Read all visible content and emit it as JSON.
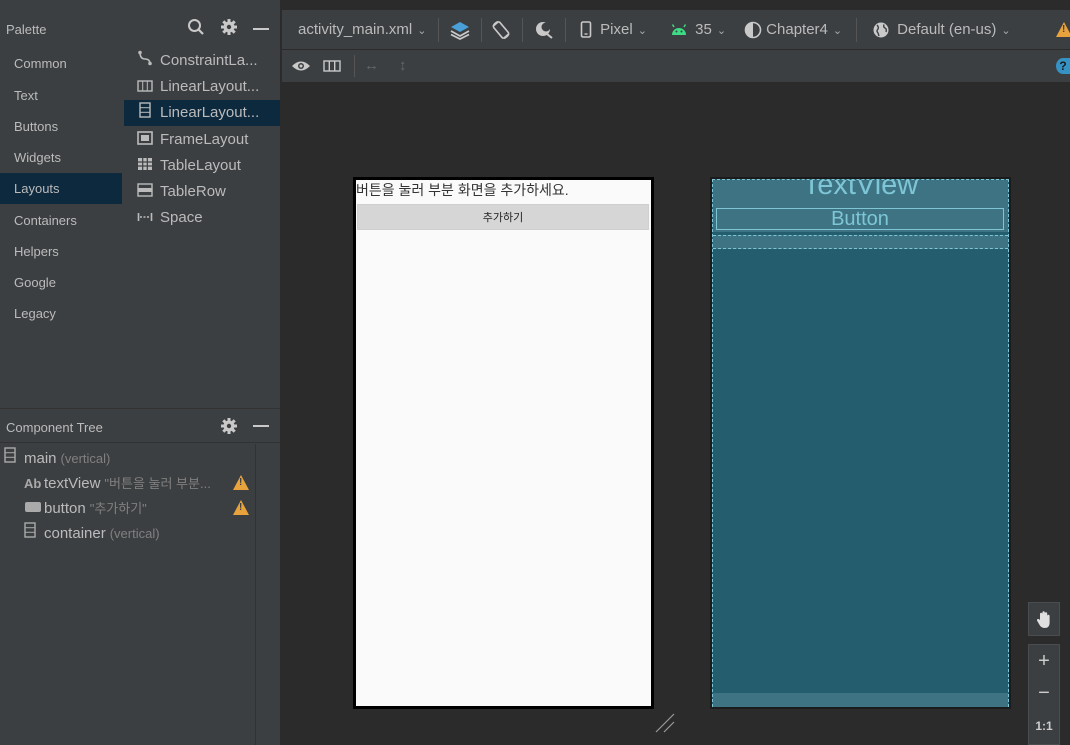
{
  "palette": {
    "title": "Palette",
    "categories": [
      {
        "label": "Common"
      },
      {
        "label": "Text"
      },
      {
        "label": "Buttons"
      },
      {
        "label": "Widgets"
      },
      {
        "label": "Layouts"
      },
      {
        "label": "Containers"
      },
      {
        "label": "Helpers"
      },
      {
        "label": "Google"
      },
      {
        "label": "Legacy"
      }
    ],
    "selected_category": "Layouts",
    "items": [
      {
        "label": "ConstraintLa...",
        "icon": "constraint-layout-icon"
      },
      {
        "label": "LinearLayout...",
        "icon": "linear-layout-horizontal-icon"
      },
      {
        "label": "LinearLayout...",
        "icon": "linear-layout-vertical-icon"
      },
      {
        "label": "FrameLayout",
        "icon": "frame-layout-icon"
      },
      {
        "label": "TableLayout",
        "icon": "table-layout-icon"
      },
      {
        "label": "TableRow",
        "icon": "table-row-icon"
      },
      {
        "label": "Space",
        "icon": "space-icon"
      }
    ]
  },
  "component_tree": {
    "title": "Component Tree",
    "rows": [
      {
        "name": "main",
        "desc": "(vertical)",
        "icon": "vertical-layout-icon",
        "warning": false
      },
      {
        "name": "textView",
        "desc": "\"버튼을 눌러 부분...",
        "icon": "text-view-icon",
        "warning": true
      },
      {
        "name": "button",
        "desc": "\"추가하기\"",
        "icon": "button-icon",
        "warning": true
      },
      {
        "name": "container",
        "desc": "(vertical)",
        "icon": "vertical-layout-icon",
        "warning": false
      }
    ]
  },
  "toolbar": {
    "file": "activity_main.xml",
    "device": "Pixel",
    "api": "35",
    "theme": "Chapter4",
    "locale": "Default (en-us)"
  },
  "design": {
    "text": "버튼을 눌러 부분 화면을 추가하세요.",
    "button": "추가하기"
  },
  "blueprint": {
    "textview": "TextView",
    "button": "Button"
  },
  "zoom": {
    "reset_label": "1:1"
  },
  "colors": {
    "accent_selection": "#0d293e",
    "warning": "#e8a33d",
    "blueprint_bg": "#245d6e",
    "blueprint_line": "#7ec6d6",
    "android_green": "#3ddc84"
  }
}
